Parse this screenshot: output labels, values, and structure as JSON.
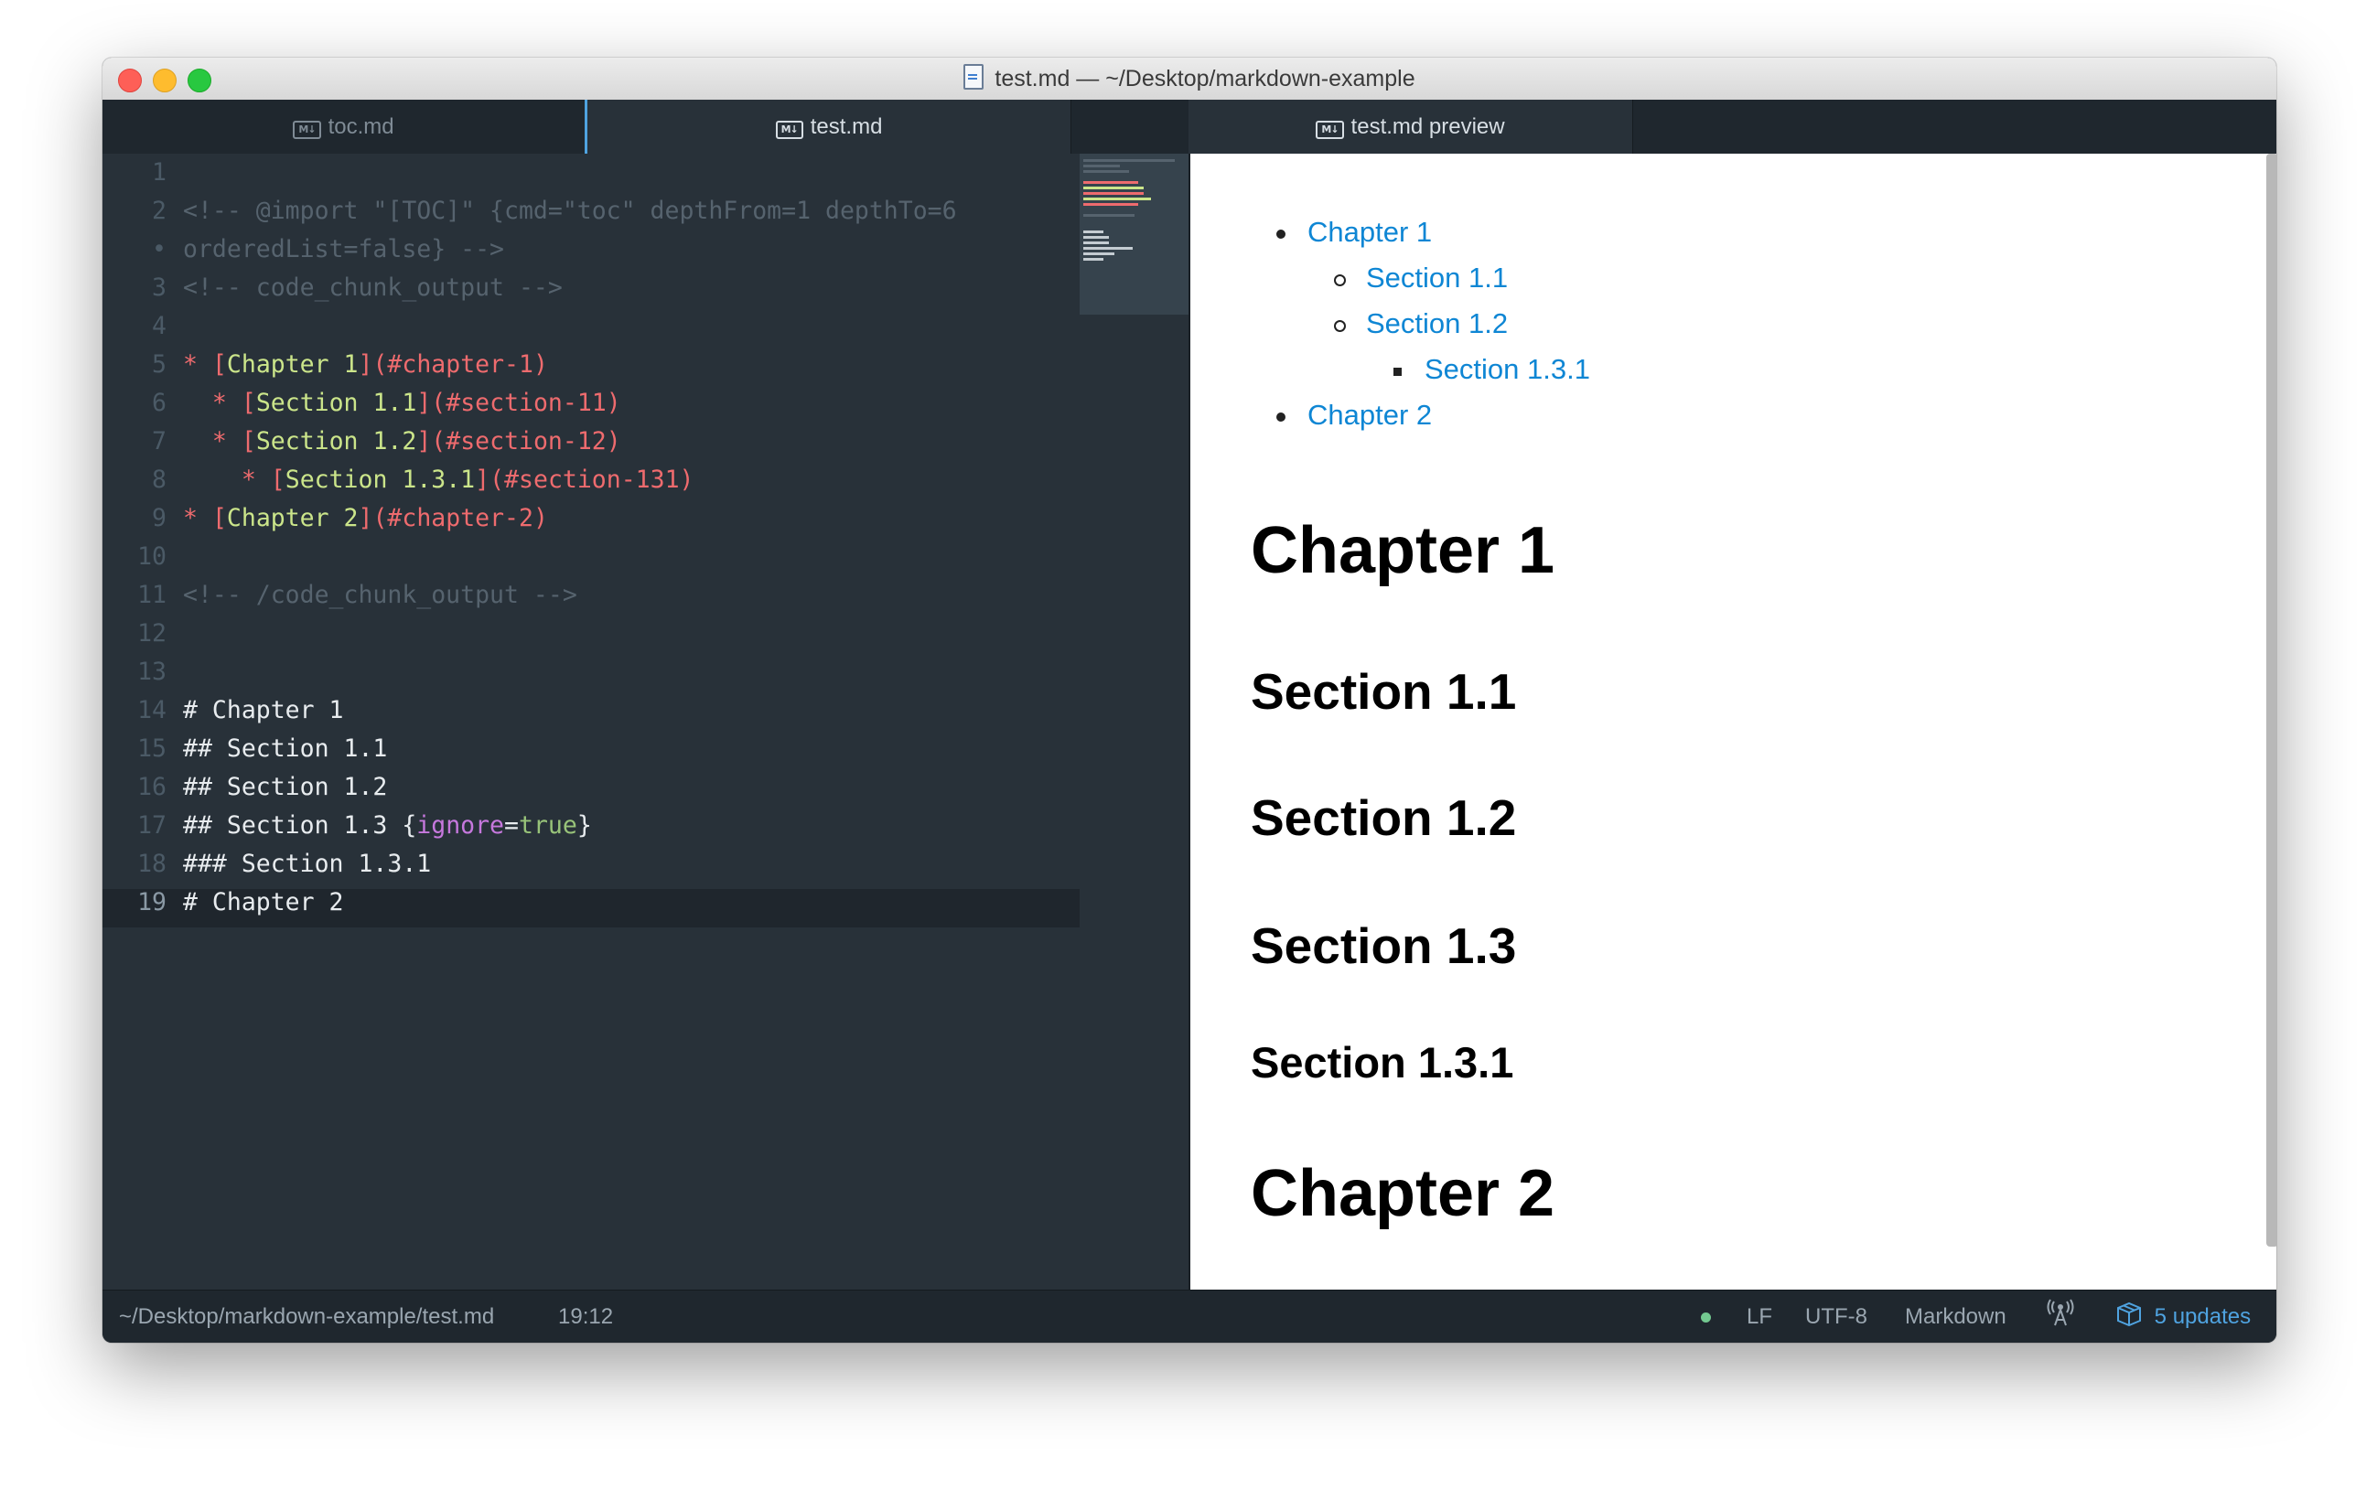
{
  "window": {
    "title": "test.md — ~/Desktop/markdown-example"
  },
  "tabs": [
    {
      "label": "toc.md",
      "icon": "markdown-icon",
      "active": false
    },
    {
      "label": "test.md",
      "icon": "markdown-icon",
      "active": true
    },
    {
      "label": "test.md preview",
      "icon": "markdown-icon",
      "active": true
    }
  ],
  "editor": {
    "line_numbers": [
      "1",
      "2",
      "•",
      "3",
      "4",
      "5",
      "6",
      "7",
      "8",
      "9",
      "10",
      "11",
      "12",
      "13",
      "14",
      "15",
      "16",
      "17",
      "18",
      "19"
    ],
    "current_line": "19",
    "lines": [
      {
        "t1": ""
      },
      {
        "comment": "<!-- @import \"[TOC]\" {cmd=\"toc\" depthFrom=1 depthTo=6"
      },
      {
        "comment": "orderedList=false} -->"
      },
      {
        "comment": "<!-- code_chunk_output -->"
      },
      {
        "t1": ""
      },
      {
        "indent": "",
        "star": "*",
        "open": "[",
        "text": "Chapter 1",
        "close": "]",
        "url": "(#chapter-1)"
      },
      {
        "indent": "  ",
        "star": "*",
        "open": "[",
        "text": "Section 1.1",
        "close": "]",
        "url": "(#section-11)"
      },
      {
        "indent": "  ",
        "star": "*",
        "open": "[",
        "text": "Section 1.2",
        "close": "]",
        "url": "(#section-12)"
      },
      {
        "indent": "    ",
        "star": "*",
        "open": "[",
        "text": "Section 1.3.1",
        "close": "]",
        "url": "(#section-131)"
      },
      {
        "indent": "",
        "star": "*",
        "open": "[",
        "text": "Chapter 2",
        "close": "]",
        "url": "(#chapter-2)"
      },
      {
        "t1": ""
      },
      {
        "comment": "<!-- /code_chunk_output -->"
      },
      {
        "t1": ""
      },
      {
        "t1": ""
      },
      {
        "t1": "# Chapter 1"
      },
      {
        "t1": "## Section 1.1"
      },
      {
        "t1": "## Section 1.2"
      },
      {
        "t1": "## Section 1.3 {",
        "attr": "ignore",
        "eq": "=",
        "val": "true",
        "t2": "}"
      },
      {
        "t1": "### Section 1.3.1"
      },
      {
        "t1": "# Chapter 2"
      }
    ]
  },
  "preview": {
    "toc": [
      {
        "label": "Chapter 1",
        "level": 1
      },
      {
        "label": "Section 1.1",
        "level": 2
      },
      {
        "label": "Section 1.2",
        "level": 2
      },
      {
        "label": "Section 1.3.1",
        "level": 3
      },
      {
        "label": "Chapter 2",
        "level": 1
      }
    ],
    "headings": [
      {
        "text": "Chapter 1",
        "level": "h1"
      },
      {
        "text": "Section 1.1",
        "level": "h2"
      },
      {
        "text": "Section 1.2",
        "level": "h2"
      },
      {
        "text": "Section 1.3",
        "level": "h2"
      },
      {
        "text": "Section 1.3.1",
        "level": "h3"
      },
      {
        "text": "Chapter 2",
        "level": "h1"
      }
    ]
  },
  "statusbar": {
    "file_path": "~/Desktop/markdown-example/test.md",
    "cursor": "19:12",
    "git_status_color": "#73c990",
    "line_ending": "LF",
    "encoding": "UTF-8",
    "grammar": "Markdown",
    "updates": "5 updates"
  },
  "colors": {
    "editor_bg": "#283139",
    "link": "#0e86d4",
    "accent": "#4fa3e0",
    "markdown_link_text": "#cbe58a",
    "markdown_link_marker": "#ee6b6e"
  }
}
